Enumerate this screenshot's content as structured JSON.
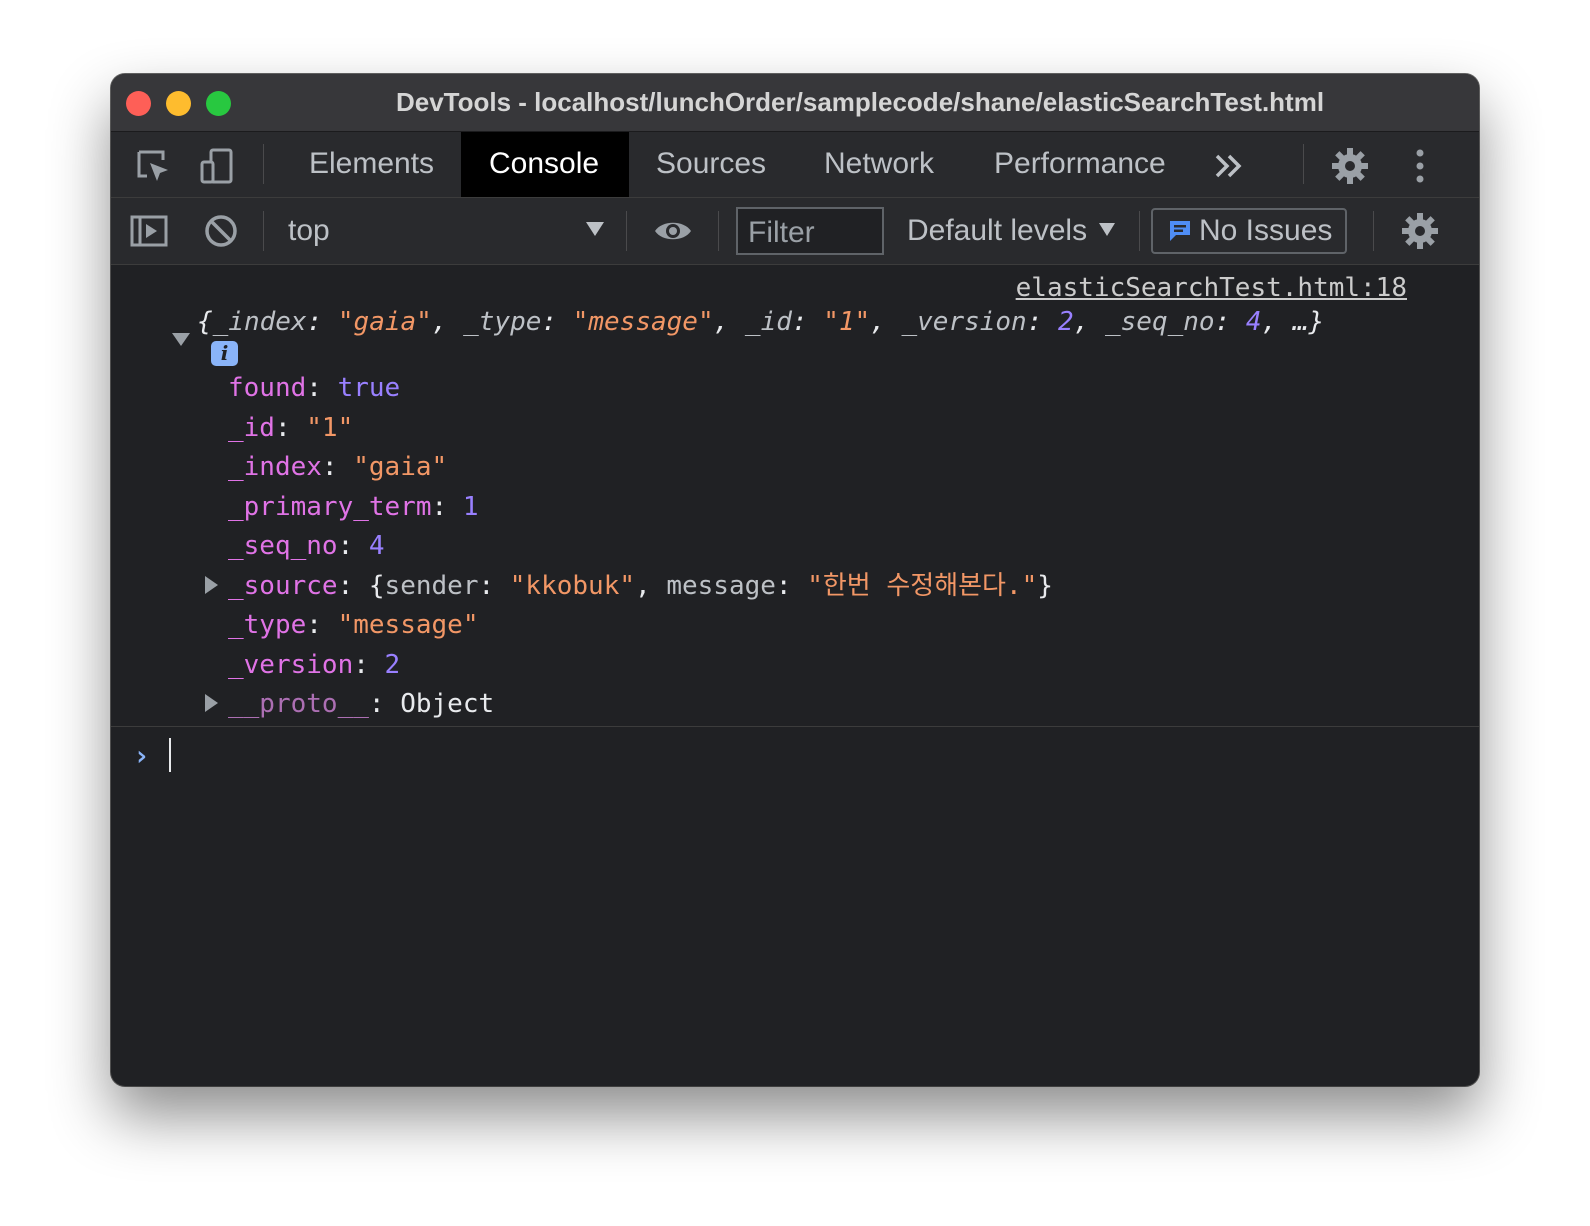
{
  "window": {
    "title": "DevTools - localhost/lunchOrder/samplecode/shane/elasticSearchTest.html"
  },
  "tabs": [
    {
      "label": "Elements",
      "active": false
    },
    {
      "label": "Console",
      "active": true
    },
    {
      "label": "Sources",
      "active": false
    },
    {
      "label": "Network",
      "active": false
    },
    {
      "label": "Performance",
      "active": false
    }
  ],
  "toolbar": {
    "context": "top",
    "filter_placeholder": "Filter",
    "levels": "Default levels",
    "issues": "No Issues"
  },
  "console": {
    "source_link": "elasticSearchTest.html:18",
    "summary": {
      "open": "{",
      "index_key": "_index",
      "index_val": "\"gaia\"",
      "type_key": "_type",
      "type_val": "\"message\"",
      "id_key": "_id",
      "id_val": "\"1\"",
      "version_key": "_version",
      "version_val": "2",
      "seq_key": "_seq_no",
      "seq_val": "4",
      "more": "…",
      "close": "}"
    },
    "info_badge": "i",
    "props": {
      "found_key": "found",
      "found_val": "true",
      "id_key": "_id",
      "id_val": "\"1\"",
      "index_key": "_index",
      "index_val": "\"gaia\"",
      "primary_term_key": "_primary_term",
      "primary_term_val": "1",
      "seq_no_key": "_seq_no",
      "seq_no_val": "4",
      "source_key": "_source",
      "source_open": "{",
      "sender_key": "sender",
      "sender_val": "\"kkobuk\"",
      "message_key": "message",
      "message_val": "\"한번 수정해본다.\"",
      "source_close": "}",
      "type_key": "_type",
      "type_val": "\"message\"",
      "version_key": "_version",
      "version_val": "2",
      "proto_key": "__proto__",
      "proto_val": "Object"
    },
    "prompt": "›"
  },
  "colors": {
    "traffic_close": "#fe5f57",
    "traffic_minimize": "#febc2e",
    "traffic_maximize": "#28c840",
    "key": "#e073e6",
    "string": "#f29766",
    "number": "#9980ff",
    "accent": "#8ab4f8"
  }
}
